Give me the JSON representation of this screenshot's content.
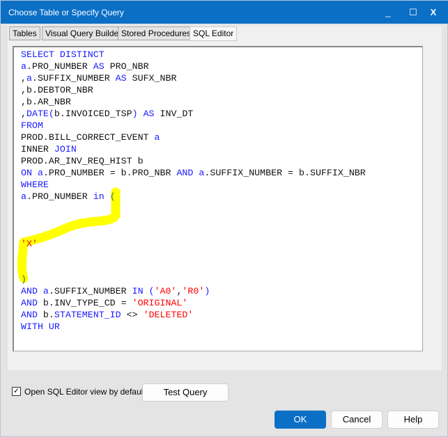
{
  "window": {
    "title": "Choose Table or Specify Query",
    "minimize": "_",
    "maximize": "☐",
    "close": "X"
  },
  "tabs": [
    {
      "label": "Tables"
    },
    {
      "label": "Visual Query Builder"
    },
    {
      "label": "Stored Procedures"
    },
    {
      "label": "SQL Editor",
      "active": true
    }
  ],
  "editor": {
    "highlight_color": "#ffff00",
    "lines": [
      [
        {
          "t": "SELECT DISTINCT",
          "c": "kw"
        }
      ],
      [
        {
          "t": "a",
          "c": "kw"
        },
        {
          "t": ".PRO_NUMBER ",
          "c": "id"
        },
        {
          "t": "AS",
          "c": "kw"
        },
        {
          "t": " PRO_NBR",
          "c": "id"
        }
      ],
      [
        {
          "t": ",",
          "c": "op"
        },
        {
          "t": "a",
          "c": "kw"
        },
        {
          "t": ".SUFFIX_NUMBER ",
          "c": "id"
        },
        {
          "t": "AS",
          "c": "kw"
        },
        {
          "t": " SUFX_NBR",
          "c": "id"
        }
      ],
      [
        {
          "t": ",b.DEBTOR_NBR",
          "c": "id"
        }
      ],
      [
        {
          "t": ",b.AR_NBR",
          "c": "id"
        }
      ],
      [
        {
          "t": ",",
          "c": "op"
        },
        {
          "t": "DATE",
          "c": "kw"
        },
        {
          "t": "(",
          "c": "kw"
        },
        {
          "t": "b.INVOICED_TSP",
          "c": "id"
        },
        {
          "t": ")",
          "c": "kw"
        },
        {
          "t": " ",
          "c": "id"
        },
        {
          "t": "AS",
          "c": "kw"
        },
        {
          "t": " INV_DT",
          "c": "id"
        }
      ],
      [
        {
          "t": "FROM",
          "c": "kw"
        }
      ],
      [
        {
          "t": "PROD.BILL_CORRECT_EVENT ",
          "c": "id"
        },
        {
          "t": "a",
          "c": "kw"
        }
      ],
      [
        {
          "t": "INNER ",
          "c": "id"
        },
        {
          "t": "JOIN",
          "c": "kw"
        }
      ],
      [
        {
          "t": "PROD.AR_INV_REQ_HIST b",
          "c": "id"
        }
      ],
      [
        {
          "t": "ON ",
          "c": "kw"
        },
        {
          "t": "a",
          "c": "kw"
        },
        {
          "t": ".PRO_NUMBER = b.PRO_NBR ",
          "c": "id"
        },
        {
          "t": "AND ",
          "c": "kw"
        },
        {
          "t": "a",
          "c": "kw"
        },
        {
          "t": ".SUFFIX_NUMBER = b.SUFFIX_NBR",
          "c": "id"
        }
      ],
      [
        {
          "t": "WHERE",
          "c": "kw"
        }
      ],
      [
        {
          "t": "a",
          "c": "kw"
        },
        {
          "t": ".PRO_NUMBER ",
          "c": "id"
        },
        {
          "t": "in",
          "c": "kw"
        },
        {
          "t": " ",
          "c": "id"
        },
        {
          "t": "(",
          "c": "par"
        }
      ],
      [],
      [],
      [],
      [
        {
          "t": "'X'",
          "c": "str"
        }
      ],
      [],
      [],
      [
        {
          "t": ")",
          "c": "par"
        }
      ],
      [
        {
          "t": "AND ",
          "c": "kw"
        },
        {
          "t": "a",
          "c": "kw"
        },
        {
          "t": ".SUFFIX_NUMBER ",
          "c": "id"
        },
        {
          "t": "IN",
          "c": "kw"
        },
        {
          "t": " (",
          "c": "kw"
        },
        {
          "t": "'A0'",
          "c": "str"
        },
        {
          "t": ",",
          "c": "op"
        },
        {
          "t": "'R0'",
          "c": "str"
        },
        {
          "t": ")",
          "c": "kw"
        }
      ],
      [
        {
          "t": "AND ",
          "c": "kw"
        },
        {
          "t": "b.INV_TYPE_CD = ",
          "c": "id"
        },
        {
          "t": "'ORIGINAL'",
          "c": "str"
        }
      ],
      [
        {
          "t": "AND ",
          "c": "kw"
        },
        {
          "t": "b.",
          "c": "id"
        },
        {
          "t": "STATEMENT_ID",
          "c": "kw"
        },
        {
          "t": " <> ",
          "c": "id"
        },
        {
          "t": "'DELETED'",
          "c": "str"
        }
      ],
      [
        {
          "t": "WITH UR",
          "c": "kw"
        }
      ]
    ]
  },
  "options": {
    "open_sql_editor_default": {
      "label": "Open SQL Editor view by default",
      "checked": true
    }
  },
  "buttons": {
    "test_query": "Test Query",
    "ok": "OK",
    "cancel": "Cancel",
    "help": "Help"
  },
  "colors": {
    "titlebar": "#0b6fc6",
    "keyword": "#1a1aff",
    "string": "#ff0000"
  }
}
